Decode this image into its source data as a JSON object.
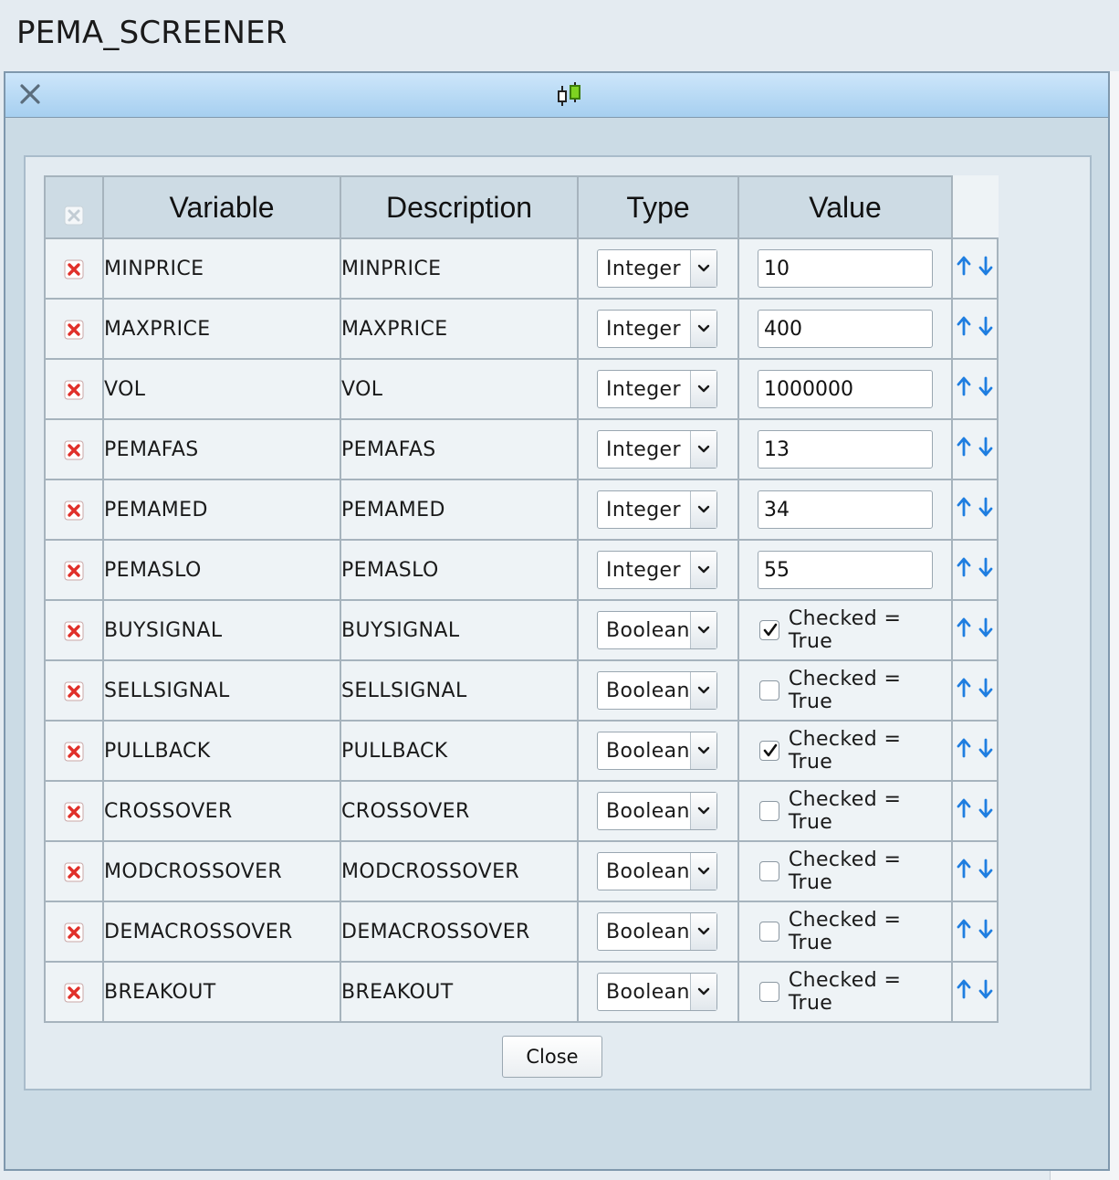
{
  "app": {
    "title": "PEMA_SCREENER"
  },
  "dialog": {
    "close_button_label": "Close"
  },
  "table": {
    "headers": {
      "variable": "Variable",
      "description": "Description",
      "type": "Type",
      "value": "Value"
    },
    "rows": [
      {
        "variable": "MINPRICE",
        "description": "MINPRICE",
        "type": "Integer",
        "value": "10"
      },
      {
        "variable": "MAXPRICE",
        "description": "MAXPRICE",
        "type": "Integer",
        "value": "400"
      },
      {
        "variable": "VOL",
        "description": "VOL",
        "type": "Integer",
        "value": "1000000"
      },
      {
        "variable": "PEMAFAS",
        "description": "PEMAFAS",
        "type": "Integer",
        "value": "13"
      },
      {
        "variable": "PEMAMED",
        "description": "PEMAMED",
        "type": "Integer",
        "value": "34"
      },
      {
        "variable": "PEMASLO",
        "description": "PEMASLO",
        "type": "Integer",
        "value": "55"
      },
      {
        "variable": "BUYSIGNAL",
        "description": "BUYSIGNAL",
        "type": "Boolean",
        "checked": true,
        "bool_label": "Checked = True"
      },
      {
        "variable": "SELLSIGNAL",
        "description": "SELLSIGNAL",
        "type": "Boolean",
        "checked": false,
        "bool_label": "Checked = True"
      },
      {
        "variable": "PULLBACK",
        "description": "PULLBACK",
        "type": "Boolean",
        "checked": true,
        "bool_label": "Checked = True"
      },
      {
        "variable": "CROSSOVER",
        "description": "CROSSOVER",
        "type": "Boolean",
        "checked": false,
        "bool_label": "Checked = True"
      },
      {
        "variable": "MODCROSSOVER",
        "description": "MODCROSSOVER",
        "type": "Boolean",
        "checked": false,
        "bool_label": "Checked = True"
      },
      {
        "variable": "DEMACROSSOVER",
        "description": "DEMACROSSOVER",
        "type": "Boolean",
        "checked": false,
        "bool_label": "Checked = True"
      },
      {
        "variable": "BREAKOUT",
        "description": "BREAKOUT",
        "type": "Boolean",
        "checked": false,
        "bool_label": "Checked = True"
      }
    ]
  },
  "colors": {
    "header_bar": "#b8dcf6",
    "delete_red": "#e0302a",
    "arrow_blue": "#1f7ee0",
    "candle_green": "#7ed321"
  },
  "icons": {
    "close": "close-x-icon",
    "app": "candlestick-icon",
    "delete": "delete-x-icon",
    "move_up": "arrow-up-icon",
    "move_down": "arrow-down-icon"
  }
}
